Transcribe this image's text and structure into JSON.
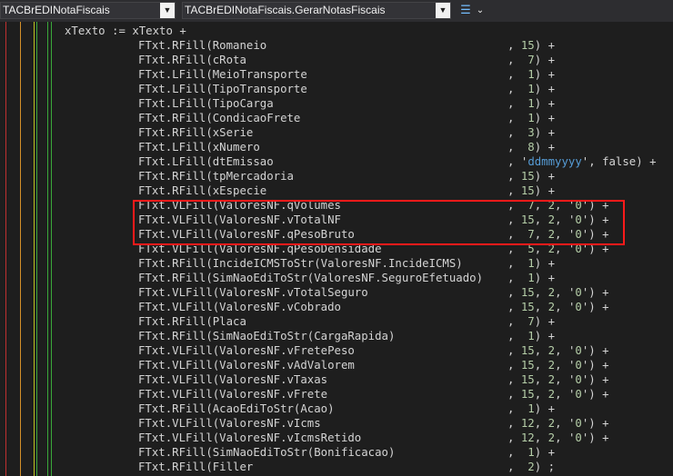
{
  "toolbar": {
    "unit_combo": "TACBrEDINotaFiscais",
    "method_combo": "TACBrEDINotaFiscais.GerarNotasFiscais",
    "icons": [
      "dropdown-arrow-icon",
      "dropdown-arrow-icon",
      "navigation-list-icon",
      "chevron-down-icon"
    ]
  },
  "editor": {
    "guide_colors": [
      "#c03030",
      "#d4902a",
      "#c0c020",
      "#3aa83a",
      "#3aa83a",
      "#3aa83a"
    ],
    "highlight_color": "#ff1a1a",
    "lines": [
      {
        "code": "xTexto := xTexto +",
        "args": "",
        "tail": ""
      },
      {
        "code": "FTxt.RFill(Romaneio",
        "args": ", 15)",
        "tail": " +"
      },
      {
        "code": "FTxt.RFill(cRota",
        "args": ",  7)",
        "tail": " +"
      },
      {
        "code": "FTxt.LFill(MeioTransporte",
        "args": ",  1)",
        "tail": " +"
      },
      {
        "code": "FTxt.LFill(TipoTransporte",
        "args": ",  1)",
        "tail": " +"
      },
      {
        "code": "FTxt.LFill(TipoCarga",
        "args": ",  1)",
        "tail": " +"
      },
      {
        "code": "FTxt.RFill(CondicaoFrete",
        "args": ",  1)",
        "tail": " +"
      },
      {
        "code": "FTxt.RFill(xSerie",
        "args": ",  3)",
        "tail": " +"
      },
      {
        "code": "FTxt.LFill(xNumero",
        "args": ",  8)",
        "tail": " +"
      },
      {
        "code": "FTxt.LFill(dtEmissao",
        "args": ", 'ddmmyyyy', false)",
        "tail": " +"
      },
      {
        "code": "FTxt.RFill(tpMercadoria",
        "args": ", 15)",
        "tail": " +"
      },
      {
        "code": "FTxt.RFill(xEspecie",
        "args": ", 15)",
        "tail": " +"
      },
      {
        "code": "FTxt.VLFill(ValoresNF.qVolumes",
        "args": ",  7, 2, '0')",
        "tail": " +"
      },
      {
        "code": "FTxt.VLFill(ValoresNF.vTotalNF",
        "args": ", 15, 2, '0')",
        "tail": " +"
      },
      {
        "code": "FTxt.VLFill(ValoresNF.qPesoBruto",
        "args": ",  7, 2, '0')",
        "tail": " +"
      },
      {
        "code": "FTxt.VLFill(ValoresNF.qPesoDensidade",
        "args": ",  5, 2, '0')",
        "tail": " +"
      },
      {
        "code": "FTxt.RFill(IncideICMSToStr(ValoresNF.IncideICMS)",
        "args": ",  1)",
        "tail": " +"
      },
      {
        "code": "FTxt.RFill(SimNaoEdiToStr(ValoresNF.SeguroEfetuado)",
        "args": ",  1)",
        "tail": " +"
      },
      {
        "code": "FTxt.VLFill(ValoresNF.vTotalSeguro",
        "args": ", 15, 2, '0')",
        "tail": " +"
      },
      {
        "code": "FTxt.VLFill(ValoresNF.vCobrado",
        "args": ", 15, 2, '0')",
        "tail": " +"
      },
      {
        "code": "FTxt.RFill(Placa",
        "args": ",  7)",
        "tail": " +"
      },
      {
        "code": "FTxt.RFill(SimNaoEdiToStr(CargaRapida)",
        "args": ",  1)",
        "tail": " +"
      },
      {
        "code": "FTxt.VLFill(ValoresNF.vFretePeso",
        "args": ", 15, 2, '0')",
        "tail": " +"
      },
      {
        "code": "FTxt.VLFill(ValoresNF.vAdValorem",
        "args": ", 15, 2, '0')",
        "tail": " +"
      },
      {
        "code": "FTxt.VLFill(ValoresNF.vTaxas",
        "args": ", 15, 2, '0')",
        "tail": " +"
      },
      {
        "code": "FTxt.VLFill(ValoresNF.vFrete",
        "args": ", 15, 2, '0')",
        "tail": " +"
      },
      {
        "code": "FTxt.RFill(AcaoEdiToStr(Acao)",
        "args": ",  1)",
        "tail": " +"
      },
      {
        "code": "FTxt.VLFill(ValoresNF.vIcms",
        "args": ", 12, 2, '0')",
        "tail": " +"
      },
      {
        "code": "FTxt.VLFill(ValoresNF.vIcmsRetido",
        "args": ", 12, 2, '0')",
        "tail": " +"
      },
      {
        "code": "FTxt.RFill(SimNaoEdiToStr(Bonificacao)",
        "args": ",  1)",
        "tail": " +"
      },
      {
        "code": "FTxt.RFill(Filler",
        "args": ",  2)",
        "tail": " ;"
      }
    ]
  }
}
